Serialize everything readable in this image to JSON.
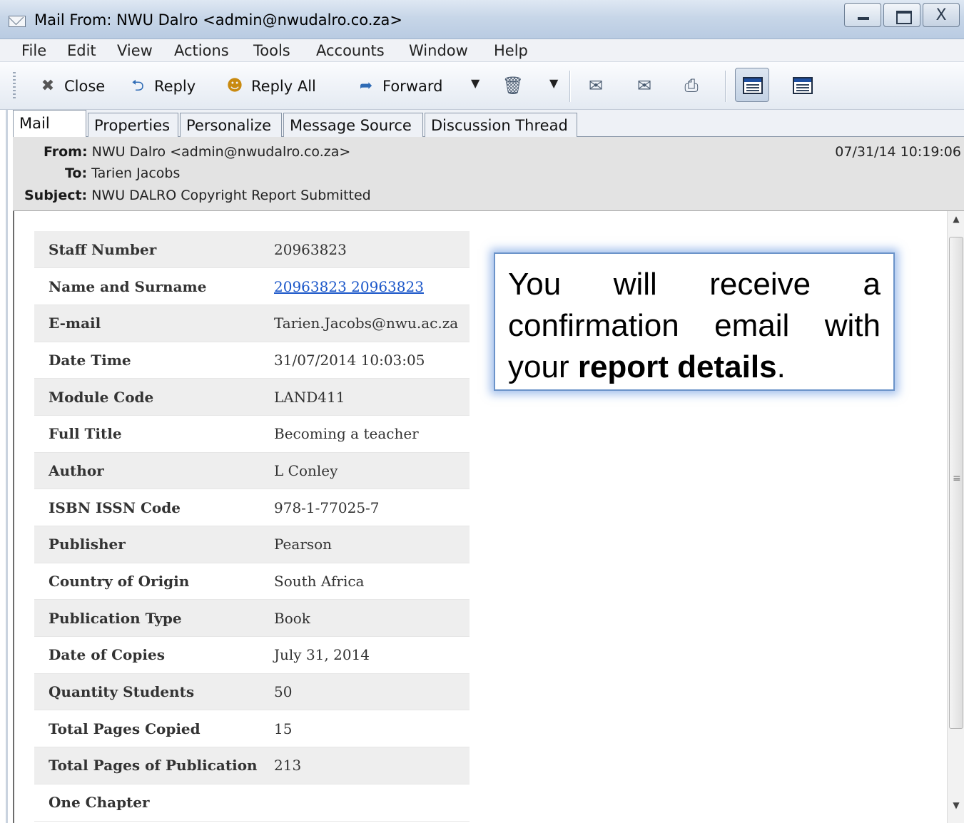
{
  "window": {
    "title": "Mail From: NWU Dalro <admin@nwudalro.co.za>",
    "close_glyph": "X"
  },
  "menu": [
    "File",
    "Edit",
    "View",
    "Actions",
    "Tools",
    "Accounts",
    "Window",
    "Help"
  ],
  "toolbar": {
    "close_label": "Close",
    "reply_label": "Reply",
    "reply_all_label": "Reply All",
    "forward_label": "Forward"
  },
  "tabs": [
    "Mail",
    "Properties",
    "Personalize",
    "Message Source",
    "Discussion Thread"
  ],
  "header": {
    "from_label": "From:",
    "from_value": "NWU Dalro <admin@nwudalro.co.za>",
    "to_label": "To:",
    "to_value": "Tarien Jacobs",
    "subject_label": "Subject:",
    "subject_value": "NWU DALRO Copyright Report Submitted",
    "date": "07/31/14 10:19:06"
  },
  "report": {
    "rows": [
      {
        "key": "Staff Number",
        "value": "20963823"
      },
      {
        "key": "Name and Surname",
        "value": "20963823 20963823"
      },
      {
        "key": "E-mail",
        "value": "Tarien.Jacobs@nwu.ac.za"
      },
      {
        "key": "Date Time",
        "value": "31/07/2014 10:03:05"
      },
      {
        "key": "Module Code",
        "value": "LAND411"
      },
      {
        "key": "Full Title",
        "value": "Becoming a teacher"
      },
      {
        "key": "Author",
        "value": "L Conley"
      },
      {
        "key": "ISBN ISSN Code",
        "value": "978-1-77025-7"
      },
      {
        "key": "Publisher",
        "value": "Pearson"
      },
      {
        "key": "Country of Origin",
        "value": "South Africa"
      },
      {
        "key": "Publication Type",
        "value": "Book"
      },
      {
        "key": "Date of Copies",
        "value": "July 31, 2014"
      },
      {
        "key": "Quantity Students",
        "value": "50"
      },
      {
        "key": "Total Pages Copied",
        "value": "15"
      },
      {
        "key": "Total Pages of Publication",
        "value": "213"
      },
      {
        "key": "One Chapter",
        "value": ""
      }
    ]
  },
  "callout": {
    "text_before": "You will receive a confirmation email with your ",
    "text_bold": "report details",
    "text_after": "."
  },
  "colors": {
    "link": "#1a56c9",
    "callout_border": "#6b93c9",
    "header_bg": "#e3e3e3"
  }
}
